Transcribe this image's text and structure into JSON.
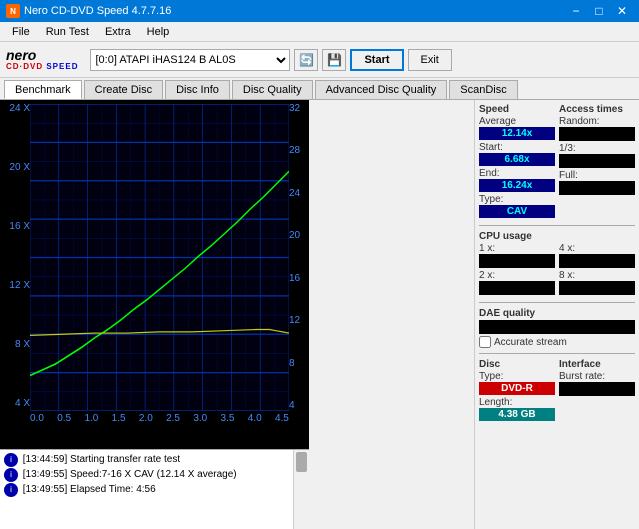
{
  "titleBar": {
    "title": "Nero CD-DVD Speed 4.7.7.16",
    "minimizeLabel": "−",
    "maximizeLabel": "□",
    "closeLabel": "✕"
  },
  "menuBar": {
    "items": [
      "File",
      "Run Test",
      "Extra",
      "Help"
    ]
  },
  "toolbar": {
    "driveValue": "[0:0]  ATAPI iHAS124  B AL0S",
    "startLabel": "Start",
    "exitLabel": "Exit"
  },
  "tabs": {
    "items": [
      "Benchmark",
      "Create Disc",
      "Disc Info",
      "Disc Quality",
      "Advanced Disc Quality",
      "ScanDisc"
    ],
    "activeIndex": 0
  },
  "chart": {
    "yAxisLeft": [
      "24 X",
      "20 X",
      "16 X",
      "12 X",
      "8 X",
      "4 X"
    ],
    "yAxisRight": [
      "32",
      "28",
      "24",
      "20",
      "16",
      "12",
      "8",
      "4"
    ],
    "xAxisLabels": [
      "0.0",
      "0.5",
      "1.0",
      "1.5",
      "2.0",
      "2.5",
      "3.0",
      "3.5",
      "4.0",
      "4.5"
    ]
  },
  "rightPanel": {
    "speedSection": {
      "title": "Speed",
      "averageLabel": "Average",
      "averageValue": "12.14x",
      "startLabel": "Start:",
      "startValue": "6.68x",
      "endLabel": "End:",
      "endValue": "16.24x",
      "typeLabel": "Type:",
      "typeValue": "CAV"
    },
    "accessTimesSection": {
      "title": "Access times",
      "randomLabel": "Random:",
      "randomValue": "",
      "oneThirdLabel": "1/3:",
      "oneThirdValue": "",
      "fullLabel": "Full:",
      "fullValue": ""
    },
    "cpuSection": {
      "title": "CPU usage",
      "x1Label": "1 x:",
      "x1Value": "",
      "x2Label": "2 x:",
      "x2Value": "",
      "x4Label": "4 x:",
      "x4Value": "",
      "x8Label": "8 x:",
      "x8Value": ""
    },
    "daeSection": {
      "title": "DAE quality",
      "daeValue": "",
      "accurateStreamLabel": "Accurate stream",
      "accurateStreamChecked": false
    },
    "discSection": {
      "title": "Disc",
      "typeLabel": "Type:",
      "typeValue": "DVD-R",
      "lengthLabel": "Length:",
      "lengthValue": "4.38 GB"
    },
    "interfaceSection": {
      "title": "Interface",
      "burstRateLabel": "Burst rate:",
      "burstRateValue": ""
    }
  },
  "log": {
    "entries": [
      {
        "time": "[13:44:59]",
        "message": "Starting transfer rate test"
      },
      {
        "time": "[13:49:55]",
        "message": "Speed:7-16 X CAV (12.14 X average)"
      },
      {
        "time": "[13:49:55]",
        "message": "Elapsed Time: 4:56"
      }
    ]
  }
}
